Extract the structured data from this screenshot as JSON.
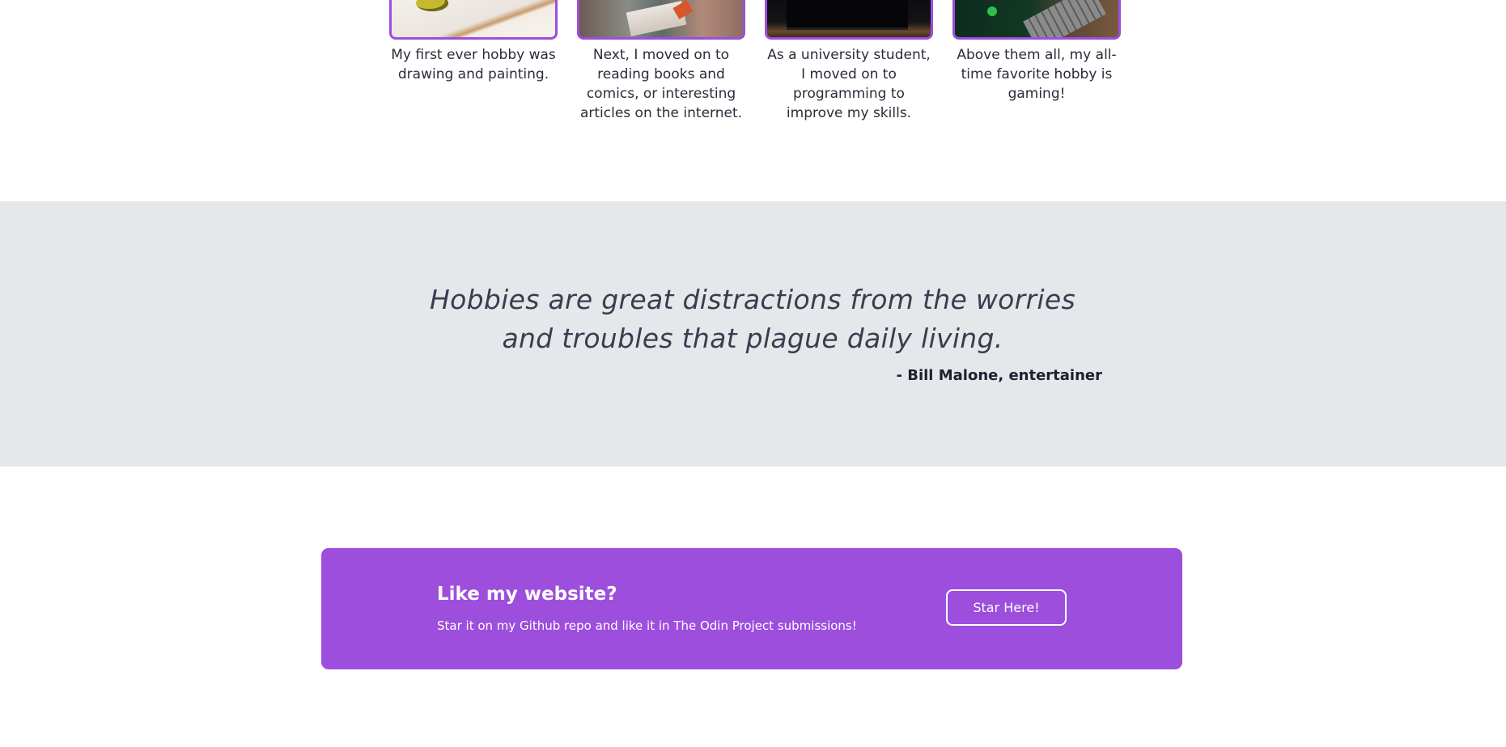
{
  "hobbies": [
    {
      "image": "drawing-and-painting-image",
      "caption": "My first ever hobby was drawing and painting."
    },
    {
      "image": "reading-books-image",
      "caption": "Next, I moved on to reading books and comics, or interesting articles on the internet."
    },
    {
      "image": "programming-laptop-image",
      "caption": "As a university student, I moved on to programming to improve my skills."
    },
    {
      "image": "gaming-keyboard-image",
      "caption": "Above them all, my all-time favorite hobby is gaming!"
    }
  ],
  "quote": {
    "text": "Hobbies are great distractions from the worries and troubles that plague daily living.",
    "author": "- Bill Malone, entertainer"
  },
  "cta": {
    "title": "Like my website?",
    "subtitle": "Star it on my Github repo and like it in The Odin Project submissions!",
    "button_label": "Star Here!"
  },
  "colors": {
    "accent": "#9d4edd",
    "quote_background": "#e5e7eb",
    "page_background": "#ffffff"
  }
}
